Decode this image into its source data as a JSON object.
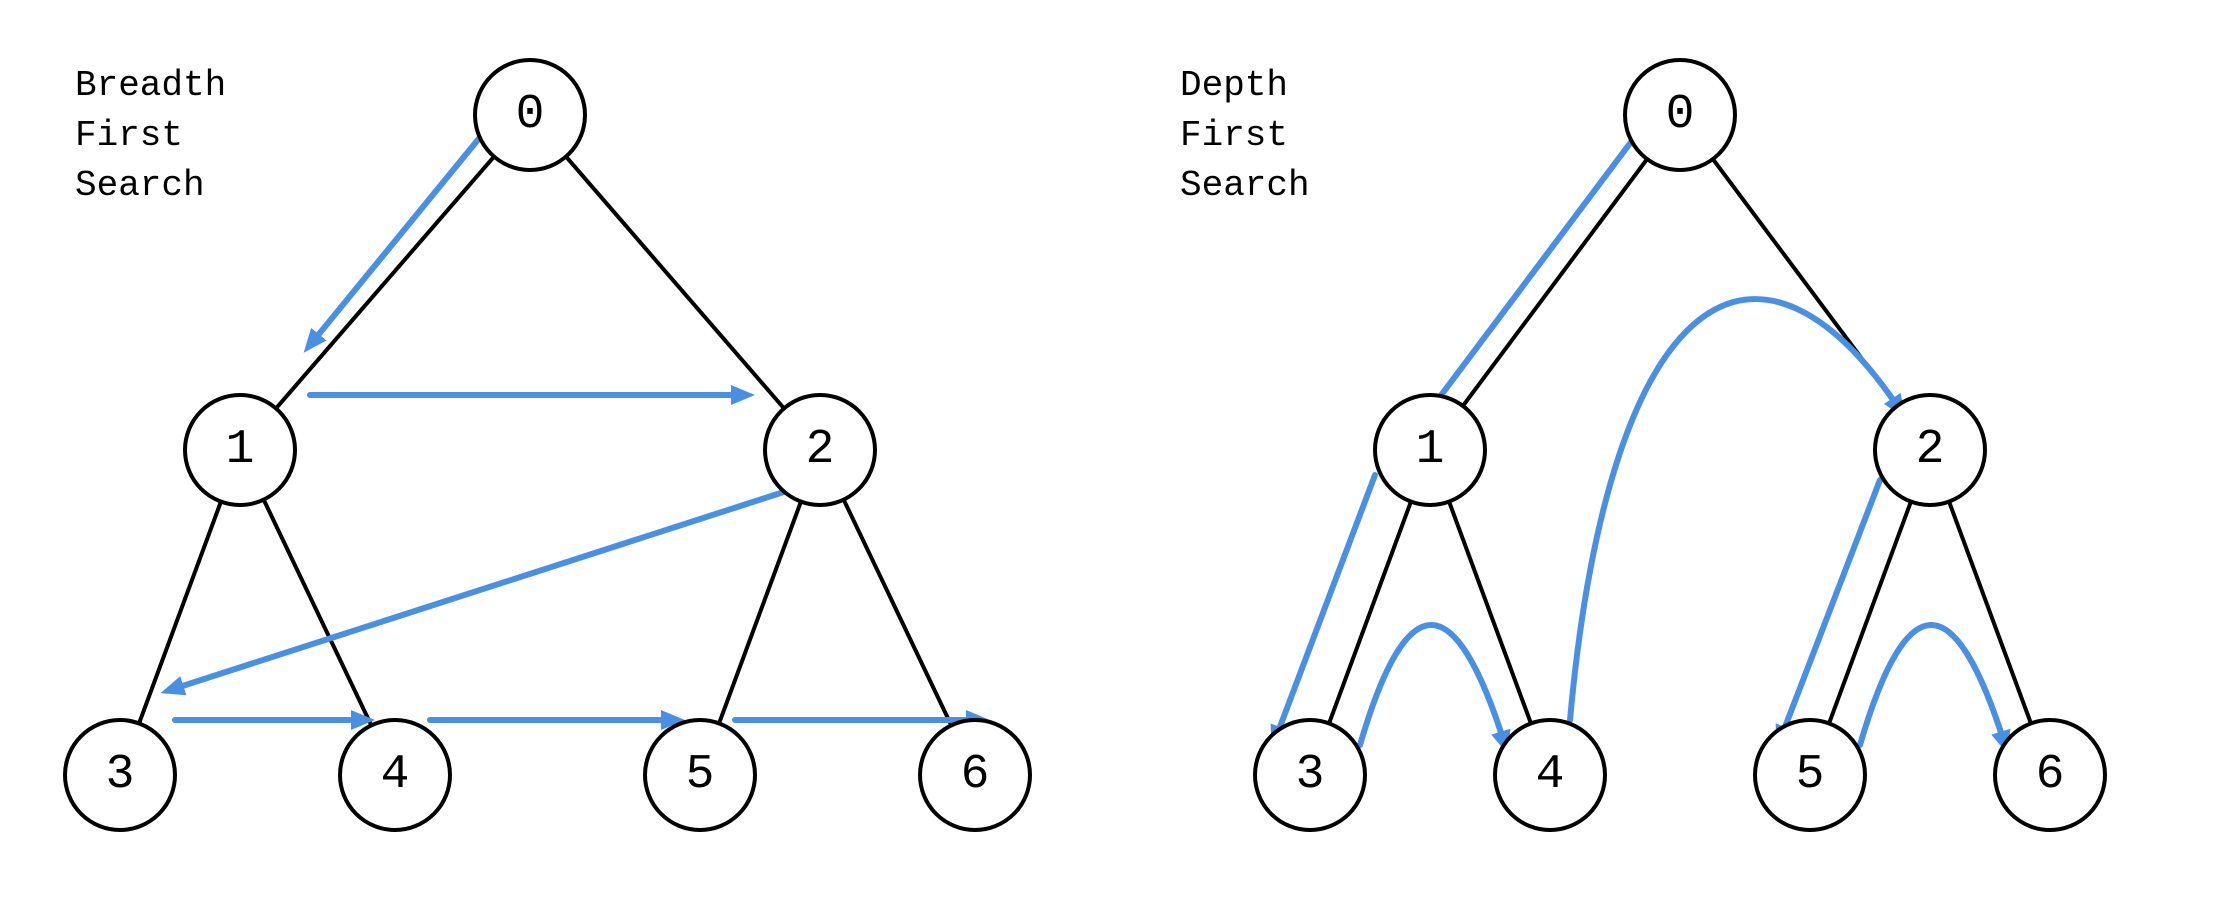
{
  "bfs": {
    "title_lines": [
      "Breadth",
      "First",
      "Search"
    ],
    "nodes": {
      "n0": "0",
      "n1": "1",
      "n2": "2",
      "n3": "3",
      "n4": "4",
      "n5": "5",
      "n6": "6"
    },
    "traversal_order": [
      0,
      1,
      2,
      3,
      4,
      5,
      6
    ]
  },
  "dfs": {
    "title_lines": [
      "Depth",
      "First",
      "Search"
    ],
    "nodes": {
      "n0": "0",
      "n1": "1",
      "n2": "2",
      "n3": "3",
      "n4": "4",
      "n5": "5",
      "n6": "6"
    },
    "traversal_order": [
      0,
      1,
      3,
      4,
      2,
      5,
      6
    ]
  },
  "tree_edges": [
    [
      "0",
      "1"
    ],
    [
      "0",
      "2"
    ],
    [
      "1",
      "3"
    ],
    [
      "1",
      "4"
    ],
    [
      "2",
      "5"
    ],
    [
      "2",
      "6"
    ]
  ],
  "colors": {
    "arrow": "#4a90e2",
    "node_stroke": "#000000",
    "node_fill": "#ffffff"
  }
}
